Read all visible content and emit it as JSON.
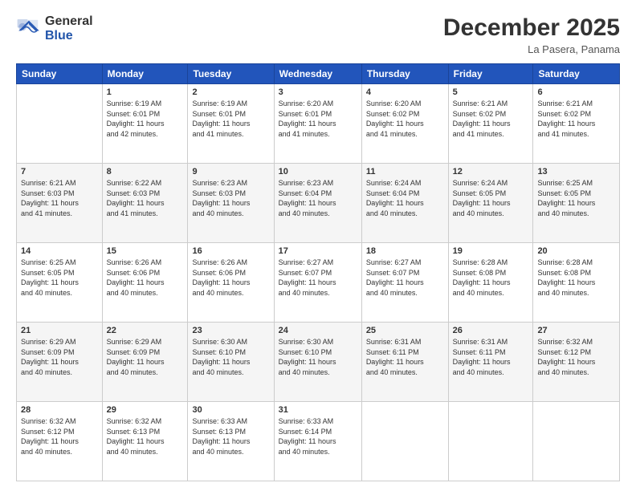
{
  "logo": {
    "general": "General",
    "blue": "Blue"
  },
  "header": {
    "month": "December 2025",
    "location": "La Pasera, Panama"
  },
  "weekdays": [
    "Sunday",
    "Monday",
    "Tuesday",
    "Wednesday",
    "Thursday",
    "Friday",
    "Saturday"
  ],
  "weeks": [
    [
      {
        "day": "",
        "info": ""
      },
      {
        "day": "1",
        "info": "Sunrise: 6:19 AM\nSunset: 6:01 PM\nDaylight: 11 hours\nand 42 minutes."
      },
      {
        "day": "2",
        "info": "Sunrise: 6:19 AM\nSunset: 6:01 PM\nDaylight: 11 hours\nand 41 minutes."
      },
      {
        "day": "3",
        "info": "Sunrise: 6:20 AM\nSunset: 6:01 PM\nDaylight: 11 hours\nand 41 minutes."
      },
      {
        "day": "4",
        "info": "Sunrise: 6:20 AM\nSunset: 6:02 PM\nDaylight: 11 hours\nand 41 minutes."
      },
      {
        "day": "5",
        "info": "Sunrise: 6:21 AM\nSunset: 6:02 PM\nDaylight: 11 hours\nand 41 minutes."
      },
      {
        "day": "6",
        "info": "Sunrise: 6:21 AM\nSunset: 6:02 PM\nDaylight: 11 hours\nand 41 minutes."
      }
    ],
    [
      {
        "day": "7",
        "info": "Sunrise: 6:21 AM\nSunset: 6:03 PM\nDaylight: 11 hours\nand 41 minutes."
      },
      {
        "day": "8",
        "info": "Sunrise: 6:22 AM\nSunset: 6:03 PM\nDaylight: 11 hours\nand 41 minutes."
      },
      {
        "day": "9",
        "info": "Sunrise: 6:23 AM\nSunset: 6:03 PM\nDaylight: 11 hours\nand 40 minutes."
      },
      {
        "day": "10",
        "info": "Sunrise: 6:23 AM\nSunset: 6:04 PM\nDaylight: 11 hours\nand 40 minutes."
      },
      {
        "day": "11",
        "info": "Sunrise: 6:24 AM\nSunset: 6:04 PM\nDaylight: 11 hours\nand 40 minutes."
      },
      {
        "day": "12",
        "info": "Sunrise: 6:24 AM\nSunset: 6:05 PM\nDaylight: 11 hours\nand 40 minutes."
      },
      {
        "day": "13",
        "info": "Sunrise: 6:25 AM\nSunset: 6:05 PM\nDaylight: 11 hours\nand 40 minutes."
      }
    ],
    [
      {
        "day": "14",
        "info": "Sunrise: 6:25 AM\nSunset: 6:05 PM\nDaylight: 11 hours\nand 40 minutes."
      },
      {
        "day": "15",
        "info": "Sunrise: 6:26 AM\nSunset: 6:06 PM\nDaylight: 11 hours\nand 40 minutes."
      },
      {
        "day": "16",
        "info": "Sunrise: 6:26 AM\nSunset: 6:06 PM\nDaylight: 11 hours\nand 40 minutes."
      },
      {
        "day": "17",
        "info": "Sunrise: 6:27 AM\nSunset: 6:07 PM\nDaylight: 11 hours\nand 40 minutes."
      },
      {
        "day": "18",
        "info": "Sunrise: 6:27 AM\nSunset: 6:07 PM\nDaylight: 11 hours\nand 40 minutes."
      },
      {
        "day": "19",
        "info": "Sunrise: 6:28 AM\nSunset: 6:08 PM\nDaylight: 11 hours\nand 40 minutes."
      },
      {
        "day": "20",
        "info": "Sunrise: 6:28 AM\nSunset: 6:08 PM\nDaylight: 11 hours\nand 40 minutes."
      }
    ],
    [
      {
        "day": "21",
        "info": "Sunrise: 6:29 AM\nSunset: 6:09 PM\nDaylight: 11 hours\nand 40 minutes."
      },
      {
        "day": "22",
        "info": "Sunrise: 6:29 AM\nSunset: 6:09 PM\nDaylight: 11 hours\nand 40 minutes."
      },
      {
        "day": "23",
        "info": "Sunrise: 6:30 AM\nSunset: 6:10 PM\nDaylight: 11 hours\nand 40 minutes."
      },
      {
        "day": "24",
        "info": "Sunrise: 6:30 AM\nSunset: 6:10 PM\nDaylight: 11 hours\nand 40 minutes."
      },
      {
        "day": "25",
        "info": "Sunrise: 6:31 AM\nSunset: 6:11 PM\nDaylight: 11 hours\nand 40 minutes."
      },
      {
        "day": "26",
        "info": "Sunrise: 6:31 AM\nSunset: 6:11 PM\nDaylight: 11 hours\nand 40 minutes."
      },
      {
        "day": "27",
        "info": "Sunrise: 6:32 AM\nSunset: 6:12 PM\nDaylight: 11 hours\nand 40 minutes."
      }
    ],
    [
      {
        "day": "28",
        "info": "Sunrise: 6:32 AM\nSunset: 6:12 PM\nDaylight: 11 hours\nand 40 minutes."
      },
      {
        "day": "29",
        "info": "Sunrise: 6:32 AM\nSunset: 6:13 PM\nDaylight: 11 hours\nand 40 minutes."
      },
      {
        "day": "30",
        "info": "Sunrise: 6:33 AM\nSunset: 6:13 PM\nDaylight: 11 hours\nand 40 minutes."
      },
      {
        "day": "31",
        "info": "Sunrise: 6:33 AM\nSunset: 6:14 PM\nDaylight: 11 hours\nand 40 minutes."
      },
      {
        "day": "",
        "info": ""
      },
      {
        "day": "",
        "info": ""
      },
      {
        "day": "",
        "info": ""
      }
    ]
  ]
}
